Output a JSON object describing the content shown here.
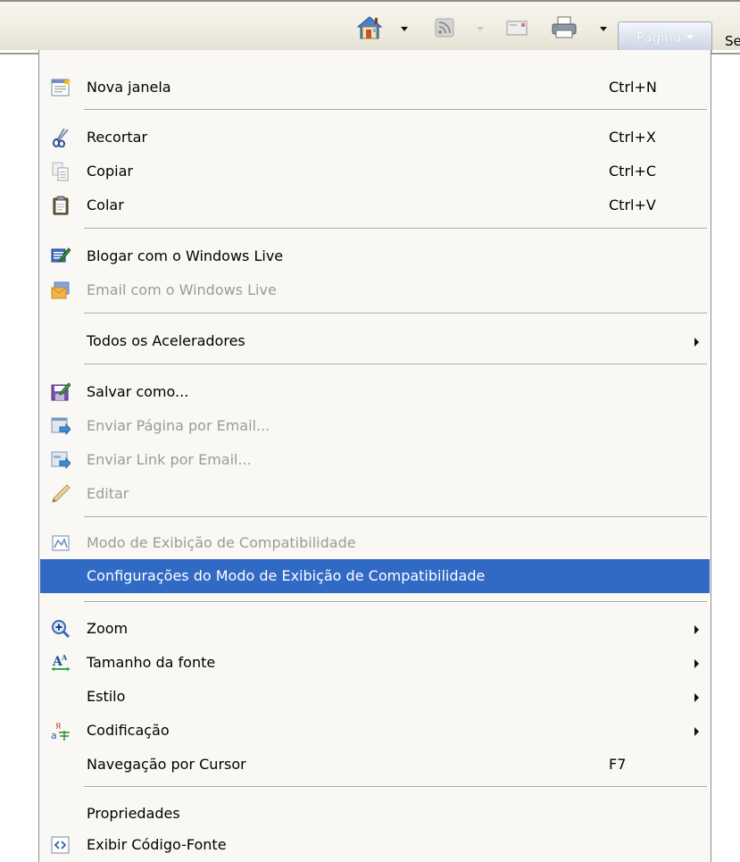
{
  "toolbar": {
    "pagina_label": "Página",
    "seguranca_partial": "Se"
  },
  "menu": {
    "items": [
      {
        "label": "Nova janela",
        "shortcut": "Ctrl+N",
        "icon": "new-window-icon"
      },
      {
        "label": "Recortar",
        "shortcut": "Ctrl+X",
        "icon": "scissors-icon"
      },
      {
        "label": "Copiar",
        "shortcut": "Ctrl+C",
        "icon": "copy-icon"
      },
      {
        "label": "Colar",
        "shortcut": "Ctrl+V",
        "icon": "clipboard-icon"
      },
      {
        "label": "Blogar com o Windows Live",
        "icon": "blog-icon"
      },
      {
        "label": "Email com o Windows Live",
        "icon": "email-live-icon",
        "disabled": true
      },
      {
        "label": "Todos os Aceleradores",
        "submenu": true
      },
      {
        "label": "Salvar como...",
        "icon": "save-icon"
      },
      {
        "label": "Enviar Página por Email...",
        "icon": "send-page-icon",
        "disabled": true
      },
      {
        "label": "Enviar Link por Email...",
        "icon": "send-link-icon",
        "disabled": true
      },
      {
        "label": "Editar",
        "icon": "pencil-icon",
        "disabled": true
      },
      {
        "label": "Modo de Exibição de Compatibilidade",
        "icon": "compatibility-icon",
        "disabled": true
      },
      {
        "label": "Configurações do Modo de Exibição de Compatibilidade",
        "selected": true
      },
      {
        "label": "Zoom",
        "icon": "zoom-icon",
        "submenu": true
      },
      {
        "label": "Tamanho da fonte",
        "icon": "font-size-icon",
        "submenu": true
      },
      {
        "label": "Estilo",
        "submenu": true
      },
      {
        "label": "Codificação",
        "icon": "encoding-icon",
        "submenu": true
      },
      {
        "label": "Navegação por Cursor",
        "shortcut": "F7"
      },
      {
        "label": "Propriedades"
      },
      {
        "label": "Exibir Código-Fonte",
        "icon": "source-code-icon"
      }
    ]
  },
  "colors": {
    "selection": "#316ac5",
    "disabled_text": "#9a9a9a",
    "menu_background": "#f9f8f4"
  }
}
